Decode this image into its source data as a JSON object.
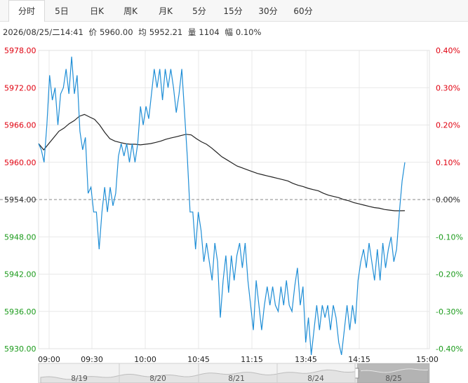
{
  "tabs": [
    {
      "label": "分时",
      "active": true
    },
    {
      "label": "5日",
      "active": false
    },
    {
      "label": "日K",
      "active": false
    },
    {
      "label": "周K",
      "active": false
    },
    {
      "label": "月K",
      "active": false
    },
    {
      "label": "5分",
      "active": false
    },
    {
      "label": "15分",
      "active": false
    },
    {
      "label": "30分",
      "active": false
    },
    {
      "label": "60分",
      "active": false
    }
  ],
  "info": {
    "datetime": "2026/08/25/二14:41",
    "price_label": "价",
    "price": "5960.00",
    "avg_label": "均",
    "avg": "5952.21",
    "volume_label": "量",
    "volume": "1104",
    "change_label": "幅",
    "change": "0.10%"
  },
  "colors": {
    "up": "#e0000f",
    "down": "#1a9a1a",
    "neutral": "#333333",
    "price_line": "#1f8ed6",
    "avg_line": "#222222",
    "grid": "#e8e8e8",
    "baseline": "#888888"
  },
  "chart_data": {
    "type": "line",
    "base_price": 5954,
    "ylim": [
      5930,
      5978
    ],
    "y_ticks": [
      "5978.00",
      "5972.00",
      "5966.00",
      "5960.00",
      "5954.00",
      "5948.00",
      "5942.00",
      "5936.00",
      "5930.00"
    ],
    "pct_ticks": [
      "0.40%",
      "0.30%",
      "0.20%",
      "0.10%",
      "0.00%",
      "-0.10%",
      "-0.20%",
      "-0.30%",
      "-0.40%"
    ],
    "x_ticks": [
      "09:00",
      "09:30",
      "10:00",
      "10:45",
      "11:15",
      "13:45",
      "14:15",
      "15:00"
    ],
    "series": [
      {
        "name": "价",
        "values": [
          5963,
          5962,
          5960,
          5966,
          5974,
          5970,
          5972,
          5966,
          5971,
          5972,
          5975,
          5971,
          5977,
          5971,
          5974,
          5965,
          5962,
          5964,
          5955,
          5956,
          5952,
          5952,
          5946,
          5952,
          5956,
          5952,
          5956,
          5953,
          5955,
          5961,
          5963,
          5961,
          5963,
          5960,
          5963,
          5960,
          5963,
          5969,
          5966,
          5969,
          5967,
          5971,
          5975,
          5972,
          5975,
          5970,
          5975,
          5972,
          5975,
          5972,
          5968,
          5971,
          5975,
          5968,
          5961,
          5952,
          5952,
          5946,
          5952,
          5949,
          5944,
          5947,
          5944,
          5941,
          5947,
          5944,
          5935,
          5941,
          5945,
          5939,
          5945,
          5941,
          5945,
          5947,
          5943,
          5947,
          5941,
          5937,
          5933,
          5941,
          5937,
          5933,
          5937,
          5940,
          5937,
          5940,
          5937,
          5936,
          5940,
          5937,
          5941,
          5937,
          5936,
          5940,
          5943,
          5937,
          5940,
          5931,
          5935,
          5929,
          5933,
          5937,
          5933,
          5937,
          5935,
          5937,
          5933,
          5937,
          5935,
          5931,
          5929,
          5933,
          5937,
          5933,
          5937,
          5934,
          5941,
          5944,
          5946,
          5943,
          5947,
          5944,
          5941,
          5946,
          5941,
          5947,
          5943,
          5946,
          5948,
          5944,
          5946,
          5952,
          5957,
          5960
        ]
      },
      {
        "name": "均",
        "values": [
          5963,
          5962,
          5963,
          5964,
          5965,
          5965.5,
          5966.2,
          5966.7,
          5967.4,
          5967.7,
          5967.3,
          5966.9,
          5966,
          5964.8,
          5963.8,
          5963.4,
          5963.2,
          5963,
          5962.9,
          5962.9,
          5962.8,
          5962.9,
          5963,
          5963.2,
          5963.4,
          5963.7,
          5963.9,
          5964.1,
          5964.3,
          5964.5,
          5964.4,
          5963.8,
          5963.3,
          5962.9,
          5962.3,
          5961.6,
          5960.9,
          5960.4,
          5959.9,
          5959.4,
          5959.1,
          5958.8,
          5958.5,
          5958.2,
          5958,
          5957.8,
          5957.6,
          5957.4,
          5957.2,
          5957,
          5956.6,
          5956.3,
          5956.1,
          5955.8,
          5955.6,
          5955.4,
          5955,
          5954.7,
          5954.5,
          5954.3,
          5954,
          5953.8,
          5953.5,
          5953.3,
          5953.1,
          5952.9,
          5952.7,
          5952.6,
          5952.4,
          5952.3,
          5952.2,
          5952.2,
          5952.21
        ]
      }
    ]
  },
  "navigator": {
    "labels": [
      "8/19",
      "8/20",
      "8/21",
      "8/24",
      "8/25"
    ]
  }
}
